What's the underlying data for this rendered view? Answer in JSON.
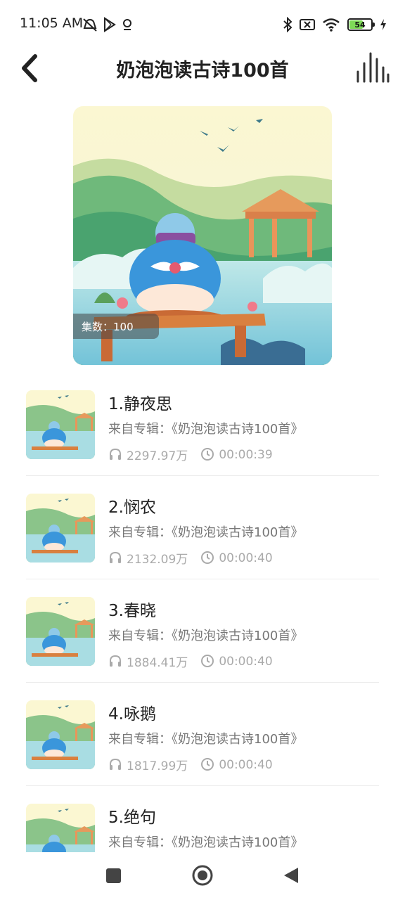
{
  "status_bar": {
    "time": "11:05 AM",
    "battery": "54"
  },
  "header": {
    "title": "奶泡泡读古诗100首"
  },
  "cover": {
    "badge": "集数：100"
  },
  "episodes": [
    {
      "title": "1.静夜思",
      "album": "来自专辑：《奶泡泡读古诗100首》",
      "plays": "2297.97万",
      "duration": "00:00:39"
    },
    {
      "title": "2.悯农",
      "album": "来自专辑：《奶泡泡读古诗100首》",
      "plays": "2132.09万",
      "duration": "00:00:40"
    },
    {
      "title": "3.春晓",
      "album": "来自专辑：《奶泡泡读古诗100首》",
      "plays": "1884.41万",
      "duration": "00:00:40"
    },
    {
      "title": "4.咏鹅",
      "album": "来自专辑：《奶泡泡读古诗100首》",
      "plays": "1817.99万",
      "duration": "00:00:40"
    },
    {
      "title": "5.绝句",
      "album": "来自专辑：《奶泡泡读古诗100首》",
      "plays": "",
      "duration": ""
    }
  ],
  "icons": {
    "back": "chevron-left-icon",
    "player": "equalizer-icon",
    "plays": "headphones-icon",
    "duration": "clock-icon"
  },
  "colors": {
    "text": "#222222",
    "secondary": "#777777",
    "meta": "#aaaaaa",
    "battery": "#7ed957"
  }
}
